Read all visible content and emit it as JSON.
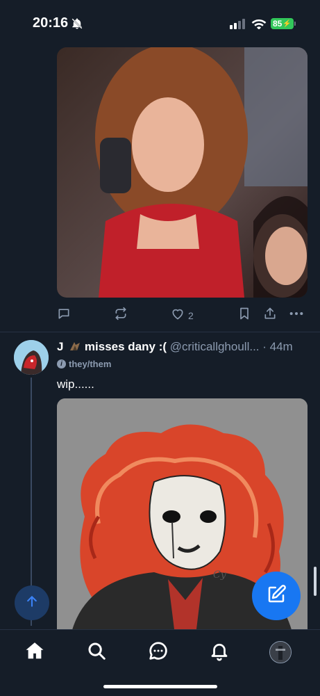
{
  "status_bar": {
    "time": "20:16",
    "battery": "85"
  },
  "post1": {
    "like_count": "2"
  },
  "post2": {
    "display_name": "J",
    "display_name_suffix": " misses dany :(",
    "handle": "@criticallghoull...",
    "separator": " · ",
    "time_ago": "44m",
    "pronouns": "they/them",
    "text": "wip......",
    "watermark": "Cy"
  },
  "colors": {
    "background": "#151d28",
    "accent": "#1877f2",
    "muted": "#8c9bb0"
  },
  "icons": {
    "reply": "speech-bubble",
    "repost": "repost-arrows",
    "like": "heart",
    "bookmark": "bookmark",
    "share": "share-upload",
    "more": "ellipsis"
  },
  "tabs": [
    "home",
    "search",
    "chat",
    "notifications",
    "profile"
  ]
}
